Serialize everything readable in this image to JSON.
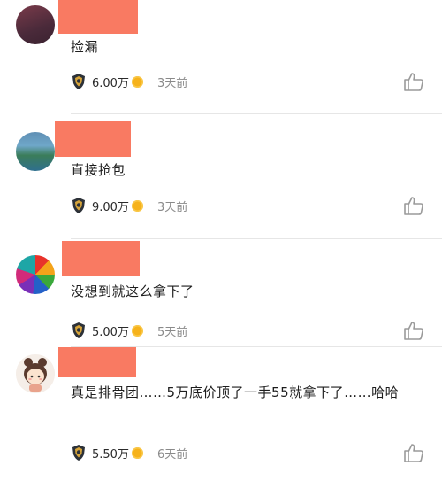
{
  "comments": [
    {
      "text": "捡漏",
      "amount": "6.00万",
      "time": "3天前"
    },
    {
      "text": "直接抢包",
      "amount": "9.00万",
      "time": "3天前"
    },
    {
      "text": "没想到就这么拿下了",
      "amount": "5.00万",
      "time": "5天前"
    },
    {
      "text": "真是排骨团……5万底价顶了一手55就拿下了……哈哈",
      "amount": "5.50万",
      "time": "6天前"
    }
  ],
  "colors": {
    "name_redaction": "#f97a62",
    "coin": "#f6b21b"
  },
  "icons": {
    "badge": "shield-badge-icon",
    "like": "thumbs-up-icon",
    "coin": "coin-icon"
  }
}
